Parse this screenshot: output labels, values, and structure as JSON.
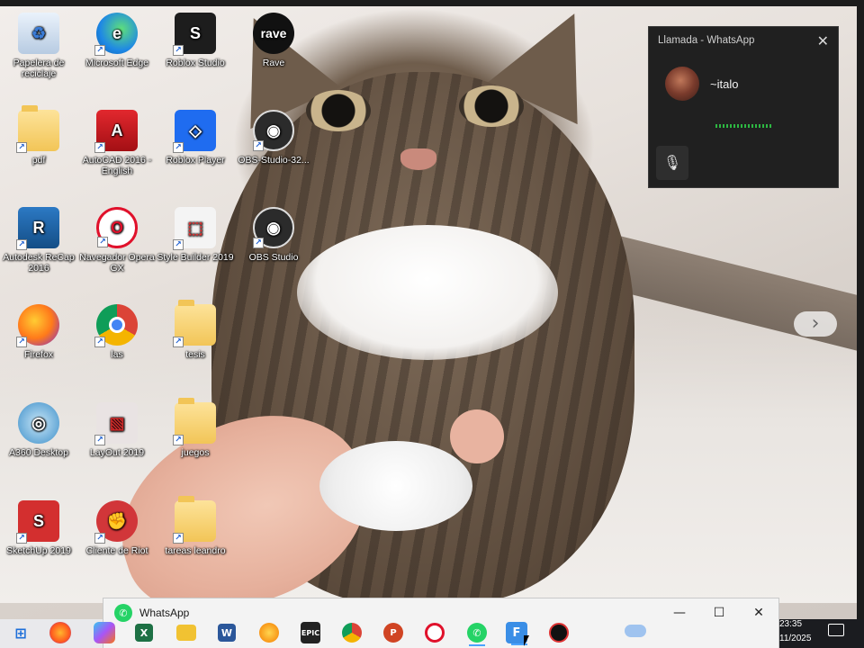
{
  "desktop_icons": [
    {
      "label": "Papelera de reciclaje",
      "icon": "recycle-bin-icon"
    },
    {
      "label": "Microsoft Edge",
      "icon": "edge-icon"
    },
    {
      "label": "Roblox Studio",
      "icon": "roblox-studio-icon"
    },
    {
      "label": "Rave",
      "icon": "rave-icon"
    },
    {
      "label": "pdf",
      "icon": "folder-icon"
    },
    {
      "label": "AutoCAD 2016 - English",
      "icon": "autocad-icon"
    },
    {
      "label": "Roblox Player",
      "icon": "roblox-player-icon"
    },
    {
      "label": "OBS-Studio-32...",
      "icon": "obs-icon"
    },
    {
      "label": "Autodesk ReCap 2016",
      "icon": "recap-icon"
    },
    {
      "label": "Navegador Opera GX",
      "icon": "opera-gx-icon"
    },
    {
      "label": "Style Builder 2019",
      "icon": "style-builder-icon"
    },
    {
      "label": "OBS Studio",
      "icon": "obs-icon"
    },
    {
      "label": "Firefox",
      "icon": "firefox-icon"
    },
    {
      "label": "las",
      "icon": "chrome-icon"
    },
    {
      "label": "tesis",
      "icon": "folder-icon"
    },
    {
      "label": "A360 Desktop",
      "icon": "a360-icon"
    },
    {
      "label": "LayOut 2019",
      "icon": "layout-icon"
    },
    {
      "label": "juegos",
      "icon": "folder-icon"
    },
    {
      "label": "SketchUp 2019",
      "icon": "sketchup-icon"
    },
    {
      "label": "Cliente de Riot",
      "icon": "riot-icon"
    },
    {
      "label": "tareas leandro",
      "icon": "folder-icon"
    }
  ],
  "call_window": {
    "title": "Llamada - WhatsApp",
    "contact_name": "~italo"
  },
  "wa_preview": {
    "title": "WhatsApp"
  },
  "taskbar": {
    "time": "23:35",
    "date": "11/2025",
    "items": [
      "windows-start-icon",
      "firefox-icon",
      "copilot-icon",
      "excel-icon",
      "file-explorer-icon",
      "word-icon",
      "edge-icon",
      "epic-games-icon",
      "chrome-icon",
      "powerpoint-icon",
      "opera-gx-icon",
      "whatsapp-icon",
      "app-icon",
      "obs-icon"
    ]
  },
  "colors": {
    "whatsapp_green": "#25d366",
    "call_bg": "#202020"
  }
}
